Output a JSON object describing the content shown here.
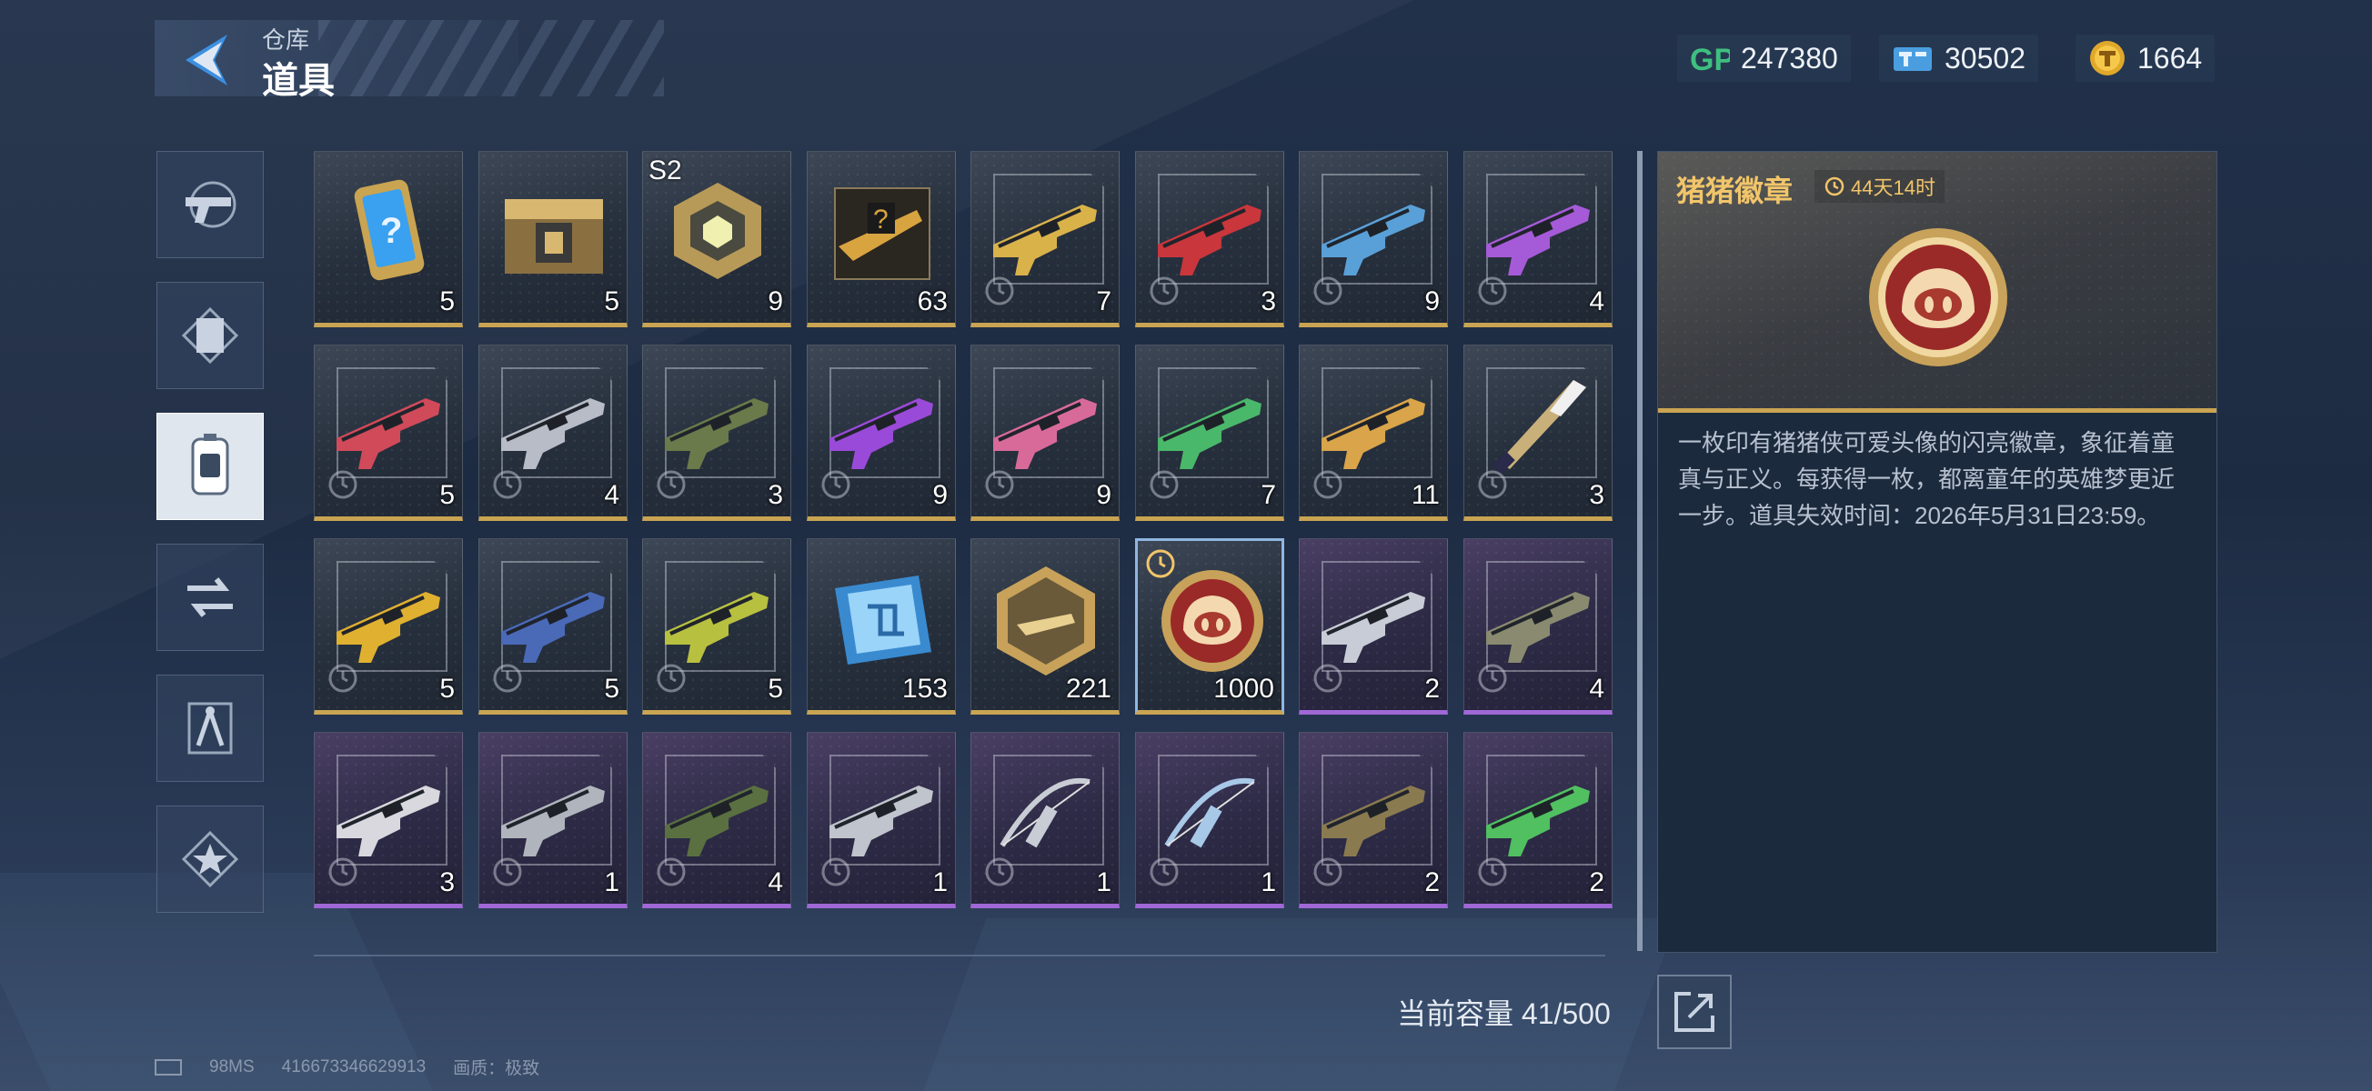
{
  "header": {
    "breadcrumb": "仓库",
    "title": "道具"
  },
  "currencies": [
    {
      "icon": "gp-icon",
      "value": "247380"
    },
    {
      "icon": "ticket-icon",
      "value": "30502"
    },
    {
      "icon": "gold-coin-icon",
      "value": "1664"
    }
  ],
  "tabs": [
    {
      "name": "weapon-tab",
      "icon": "pistol-icon"
    },
    {
      "name": "card-tab",
      "icon": "card-frame-icon"
    },
    {
      "name": "item-tab",
      "icon": "item-pack-icon",
      "active": true
    },
    {
      "name": "swap-tab",
      "icon": "swap-icon"
    },
    {
      "name": "blueprint-tab",
      "icon": "compass-icon"
    },
    {
      "name": "favorite-tab",
      "icon": "star-icon"
    }
  ],
  "items": [
    {
      "count": "5",
      "kind": "phone",
      "rarity": "gold",
      "timer": false
    },
    {
      "count": "5",
      "kind": "crate",
      "rarity": "gold",
      "timer": false
    },
    {
      "count": "9",
      "kind": "orb",
      "rarity": "gold",
      "timer": false,
      "label": "S2"
    },
    {
      "count": "63",
      "kind": "mystery-gun",
      "rarity": "gold",
      "timer": false
    },
    {
      "count": "7",
      "kind": "gun",
      "rarity": "gold",
      "timer": true,
      "color": "#d9b24a"
    },
    {
      "count": "3",
      "kind": "gun",
      "rarity": "gold",
      "timer": true,
      "color": "#c9363c"
    },
    {
      "count": "9",
      "kind": "gun",
      "rarity": "gold",
      "timer": true,
      "color": "#5aa0d8"
    },
    {
      "count": "4",
      "kind": "gun",
      "rarity": "gold",
      "timer": true,
      "color": "#a55ad8"
    },
    {
      "count": "5",
      "kind": "gun",
      "rarity": "gold",
      "timer": true,
      "color": "#d04a5a"
    },
    {
      "count": "4",
      "kind": "gun",
      "rarity": "gold",
      "timer": true,
      "color": "#b8bcc6"
    },
    {
      "count": "3",
      "kind": "gun",
      "rarity": "gold",
      "timer": true,
      "color": "#6a7a4a"
    },
    {
      "count": "9",
      "kind": "gun",
      "rarity": "gold",
      "timer": true,
      "color": "#9a4ad8"
    },
    {
      "count": "9",
      "kind": "gun",
      "rarity": "gold",
      "timer": true,
      "color": "#d86a9a"
    },
    {
      "count": "7",
      "kind": "gun",
      "rarity": "gold",
      "timer": true,
      "color": "#4ab86a"
    },
    {
      "count": "11",
      "kind": "gun",
      "rarity": "gold",
      "timer": true,
      "color": "#d9a44a"
    },
    {
      "count": "3",
      "kind": "blade",
      "rarity": "gold",
      "timer": true,
      "color": "#c9b07a"
    },
    {
      "count": "5",
      "kind": "gun",
      "rarity": "gold",
      "timer": true,
      "color": "#e0b030"
    },
    {
      "count": "5",
      "kind": "gun",
      "rarity": "gold",
      "timer": true,
      "color": "#4a6ab8"
    },
    {
      "count": "5",
      "kind": "gun",
      "rarity": "gold",
      "timer": true,
      "color": "#b8c040"
    },
    {
      "count": "153",
      "kind": "chip",
      "rarity": "gold",
      "timer": false
    },
    {
      "count": "221",
      "kind": "hex-badge",
      "rarity": "gold",
      "timer": false
    },
    {
      "count": "1000",
      "kind": "pig-badge",
      "rarity": "gold",
      "timer": true,
      "selected": true
    },
    {
      "count": "2",
      "kind": "gun",
      "rarity": "purple",
      "timer": true,
      "color": "#c8ccd6"
    },
    {
      "count": "4",
      "kind": "gun",
      "rarity": "purple",
      "timer": true,
      "color": "#8a8a70"
    },
    {
      "count": "3",
      "kind": "gun",
      "rarity": "purple",
      "timer": true,
      "color": "#d8d8de"
    },
    {
      "count": "1",
      "kind": "gun",
      "rarity": "purple",
      "timer": true,
      "color": "#b0b4bc"
    },
    {
      "count": "4",
      "kind": "gun",
      "rarity": "purple",
      "timer": true,
      "color": "#5a7040"
    },
    {
      "count": "1",
      "kind": "gun",
      "rarity": "purple",
      "timer": true,
      "color": "#c0c4cc"
    },
    {
      "count": "1",
      "kind": "bow",
      "rarity": "purple",
      "timer": true,
      "color": "#c8ccd4"
    },
    {
      "count": "1",
      "kind": "bow",
      "rarity": "purple",
      "timer": true,
      "color": "#a8c8e8"
    },
    {
      "count": "2",
      "kind": "gun",
      "rarity": "purple",
      "timer": true,
      "color": "#8a7a50"
    },
    {
      "count": "2",
      "kind": "gun",
      "rarity": "purple",
      "timer": true,
      "color": "#50c060"
    }
  ],
  "capacity": "当前容量 41/500",
  "detail": {
    "name": "猪猪徽章",
    "expiry": "44天14时",
    "description": "一枚印有猪猪侠可爱头像的闪亮徽章，象征着童真与正义。每获得一枚，都离童年的英雄梦更近一步。道具失效时间：2026年5月31日23:59。"
  },
  "footer": {
    "ping": "98MS",
    "id": "416673346629913",
    "quality": "画质：极致"
  }
}
